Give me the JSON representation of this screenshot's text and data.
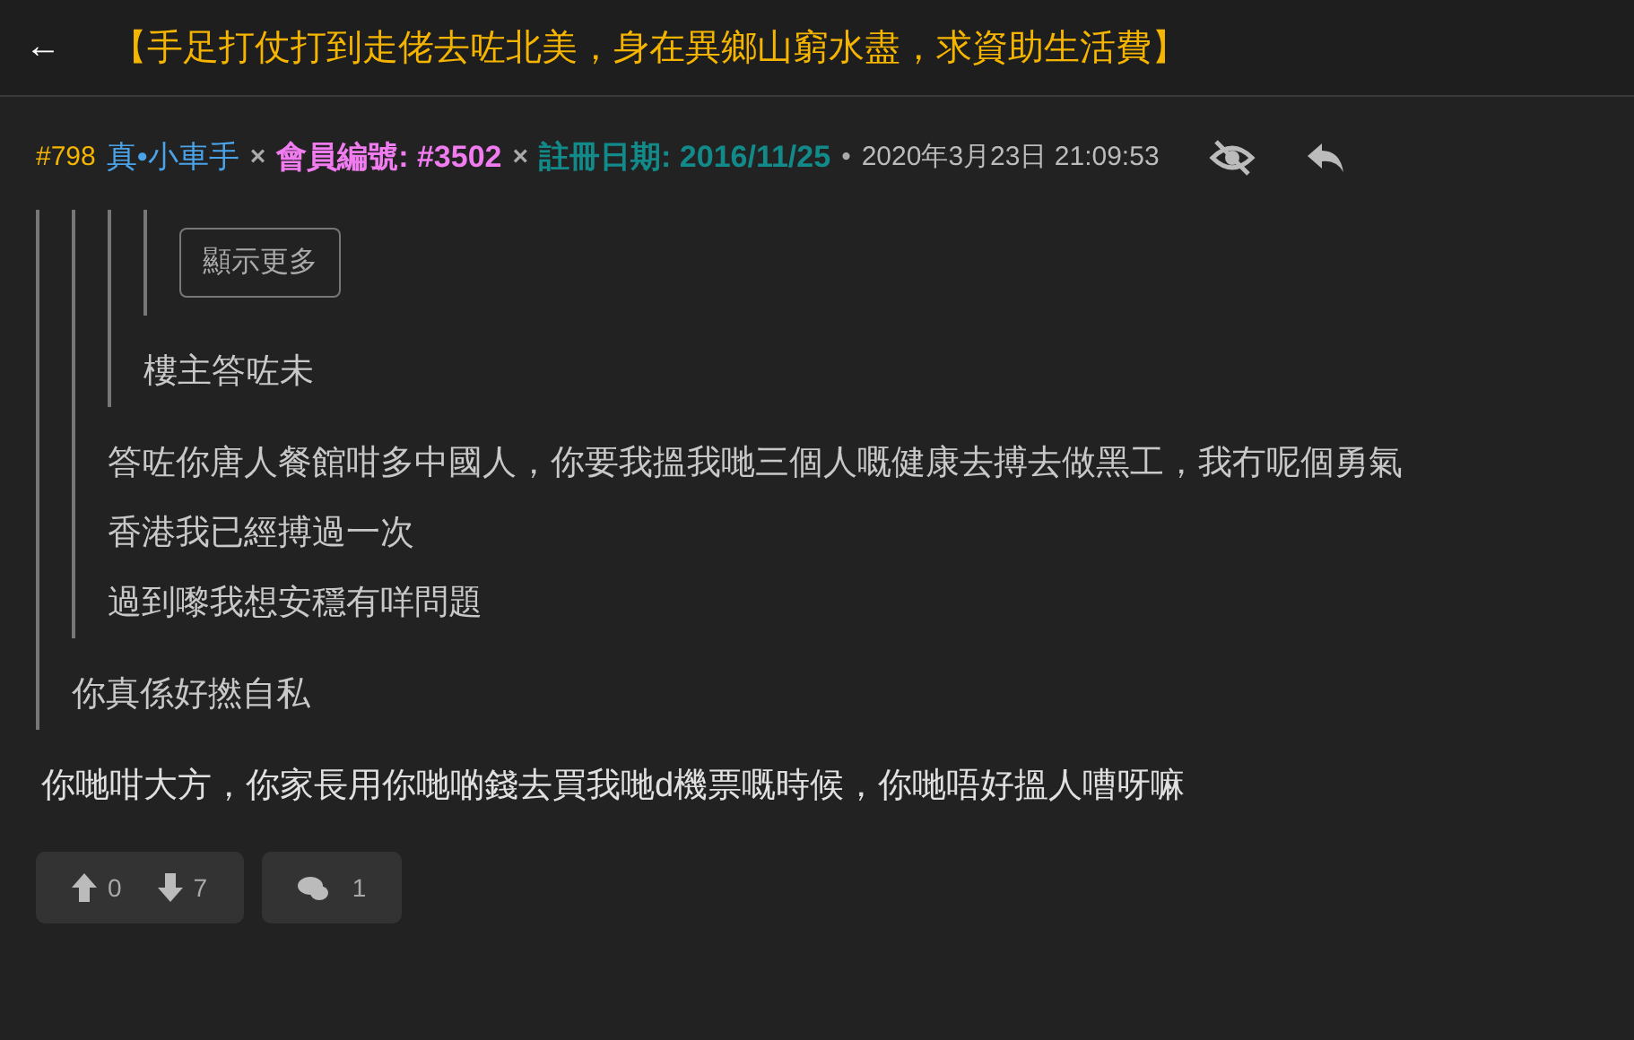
{
  "header": {
    "back": "←",
    "title": "【手足打仗打到走佬去咗北美，身在異鄉山窮水盡，求資助生活費】"
  },
  "post": {
    "number": "#798",
    "author": "真•小車手",
    "sep1": "×",
    "member_label": "會員編號: #3502",
    "sep2": "×",
    "register_label": "註冊日期: 2016/11/25",
    "dot": "•",
    "time": "2020年3月23日 21:09:53",
    "quote": {
      "lines": [
        "你真係好撚自私"
      ],
      "quote": {
        "lines": [
          "答咗你唐人餐館咁多中國人，你要我搵我哋三個人嘅健康去搏去做黑工，我冇呢個勇氣",
          "香港我已經搏過一次",
          "過到嚟我想安穩有咩問題"
        ],
        "quote": {
          "lines": [
            "樓主答咗未"
          ],
          "quote": {
            "show_more": "顯示更多"
          }
        }
      }
    },
    "body": "你哋咁大方，你家長用你哋啲錢去買我哋d機票嘅時候，你哋唔好搵人嘈呀嘛",
    "upvotes": "0",
    "downvotes": "7",
    "replies": "1"
  }
}
